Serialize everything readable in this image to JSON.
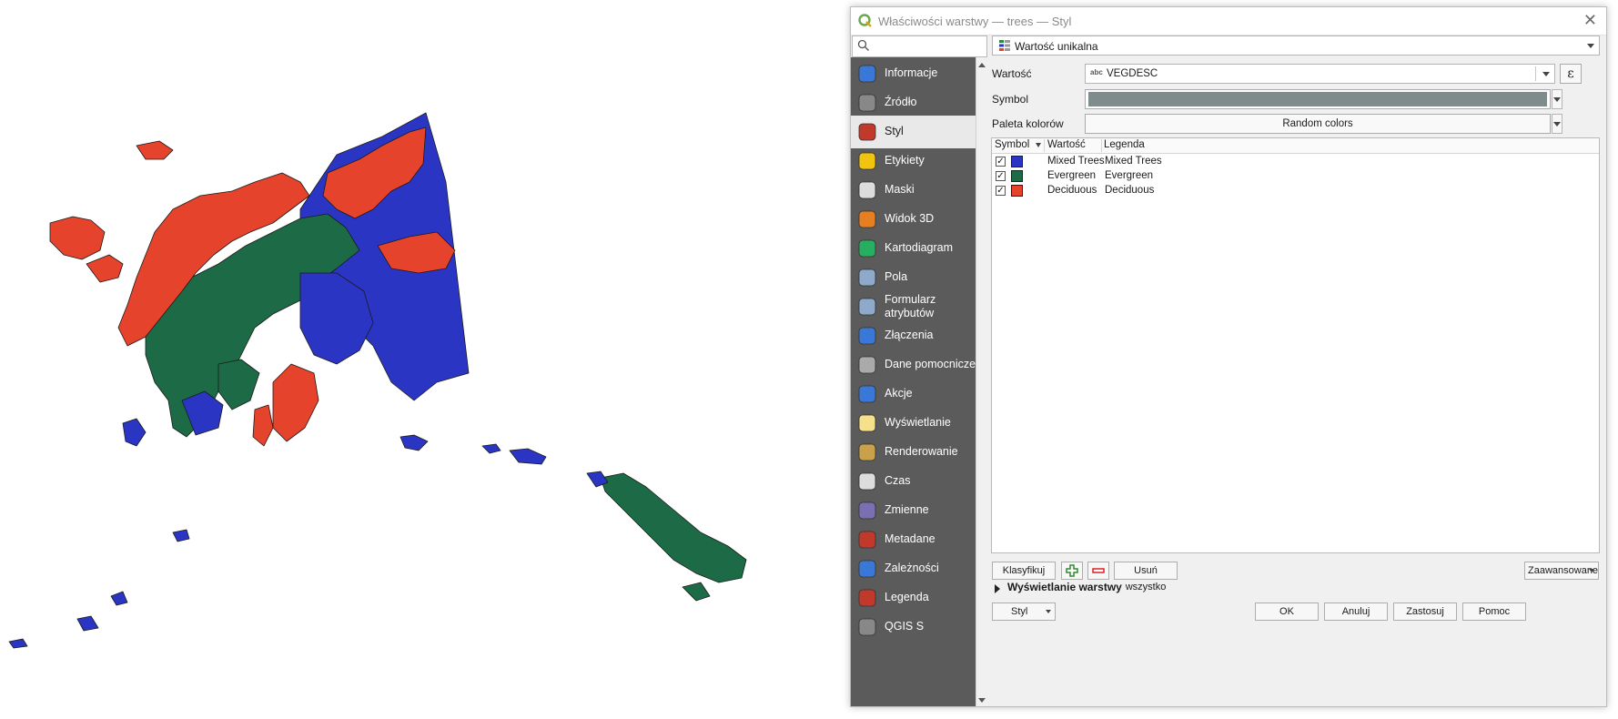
{
  "window": {
    "title": "Właściwości warstwy — trees — Styl",
    "close_glyph": "✕"
  },
  "sidebar": {
    "items": [
      {
        "label": "Informacje",
        "icon": "info-icon"
      },
      {
        "label": "Źródło",
        "icon": "source-wrench-icon"
      },
      {
        "label": "Styl",
        "icon": "style-brush-icon"
      },
      {
        "label": "Etykiety",
        "icon": "labels-abc-icon"
      },
      {
        "label": "Maski",
        "icon": "masks-abc-icon"
      },
      {
        "label": "Widok 3D",
        "icon": "cube-3d-icon"
      },
      {
        "label": "Kartodiagram",
        "icon": "diagram-icon"
      },
      {
        "label": "Pola",
        "icon": "fields-icon"
      },
      {
        "label": "Formularz",
        "label2": "atrybutów",
        "icon": "form-icon"
      },
      {
        "label": "Złączenia",
        "icon": "joins-icon"
      },
      {
        "label": "Dane pomocnicze",
        "icon": "auxiliary-storage-icon"
      },
      {
        "label": "Akcje",
        "icon": "actions-gear-icon"
      },
      {
        "label": "Wyświetlanie",
        "icon": "display-speech-icon"
      },
      {
        "label": "Renderowanie",
        "icon": "rendering-brush-icon"
      },
      {
        "label": "Czas",
        "icon": "clock-icon"
      },
      {
        "label": "Zmienne",
        "icon": "variables-icon"
      },
      {
        "label": "Metadane",
        "icon": "metadata-icon"
      },
      {
        "label": "Zależności",
        "icon": "dependencies-icon"
      },
      {
        "label": "Legenda",
        "icon": "legend-icon"
      },
      {
        "label": "QGIS S",
        "icon": "qgis-server-icon"
      }
    ],
    "active_index": 2
  },
  "style": {
    "renderer": "Wartość unikalna",
    "value_label": "Wartość",
    "field_type": "abc",
    "field_value": "VEGDESC",
    "expression_glyph": "ε",
    "symbol_label": "Symbol",
    "symbol_color": "#7f8c8d",
    "palette_label": "Paleta kolorów",
    "palette_value": "Random colors"
  },
  "table": {
    "headers": [
      "Symbol",
      "Wartość",
      "Legenda"
    ],
    "rows": [
      {
        "checked": true,
        "color": "#2b35c4",
        "value": "Mixed Trees",
        "legend": "Mixed Trees"
      },
      {
        "checked": true,
        "color": "#1d6b46",
        "value": "Evergreen",
        "legend": "Evergreen"
      },
      {
        "checked": true,
        "color": "#e6432c",
        "value": "Deciduous",
        "legend": "Deciduous"
      }
    ]
  },
  "buttons": {
    "classify": "Klasyfikuj",
    "delete_all": "Usuń wszystko",
    "advanced": "Zaawansowane",
    "layer_rendering": "Wyświetlanie warstwy",
    "style_menu": "Styl",
    "ok": "OK",
    "cancel": "Anuluj",
    "apply": "Zastosuj",
    "help": "Pomoc"
  },
  "map": {
    "colors": {
      "mixed": "#2b35c4",
      "evergreen": "#1d6b46",
      "deciduous": "#e6432c",
      "outline": "#1a1a1a"
    }
  }
}
